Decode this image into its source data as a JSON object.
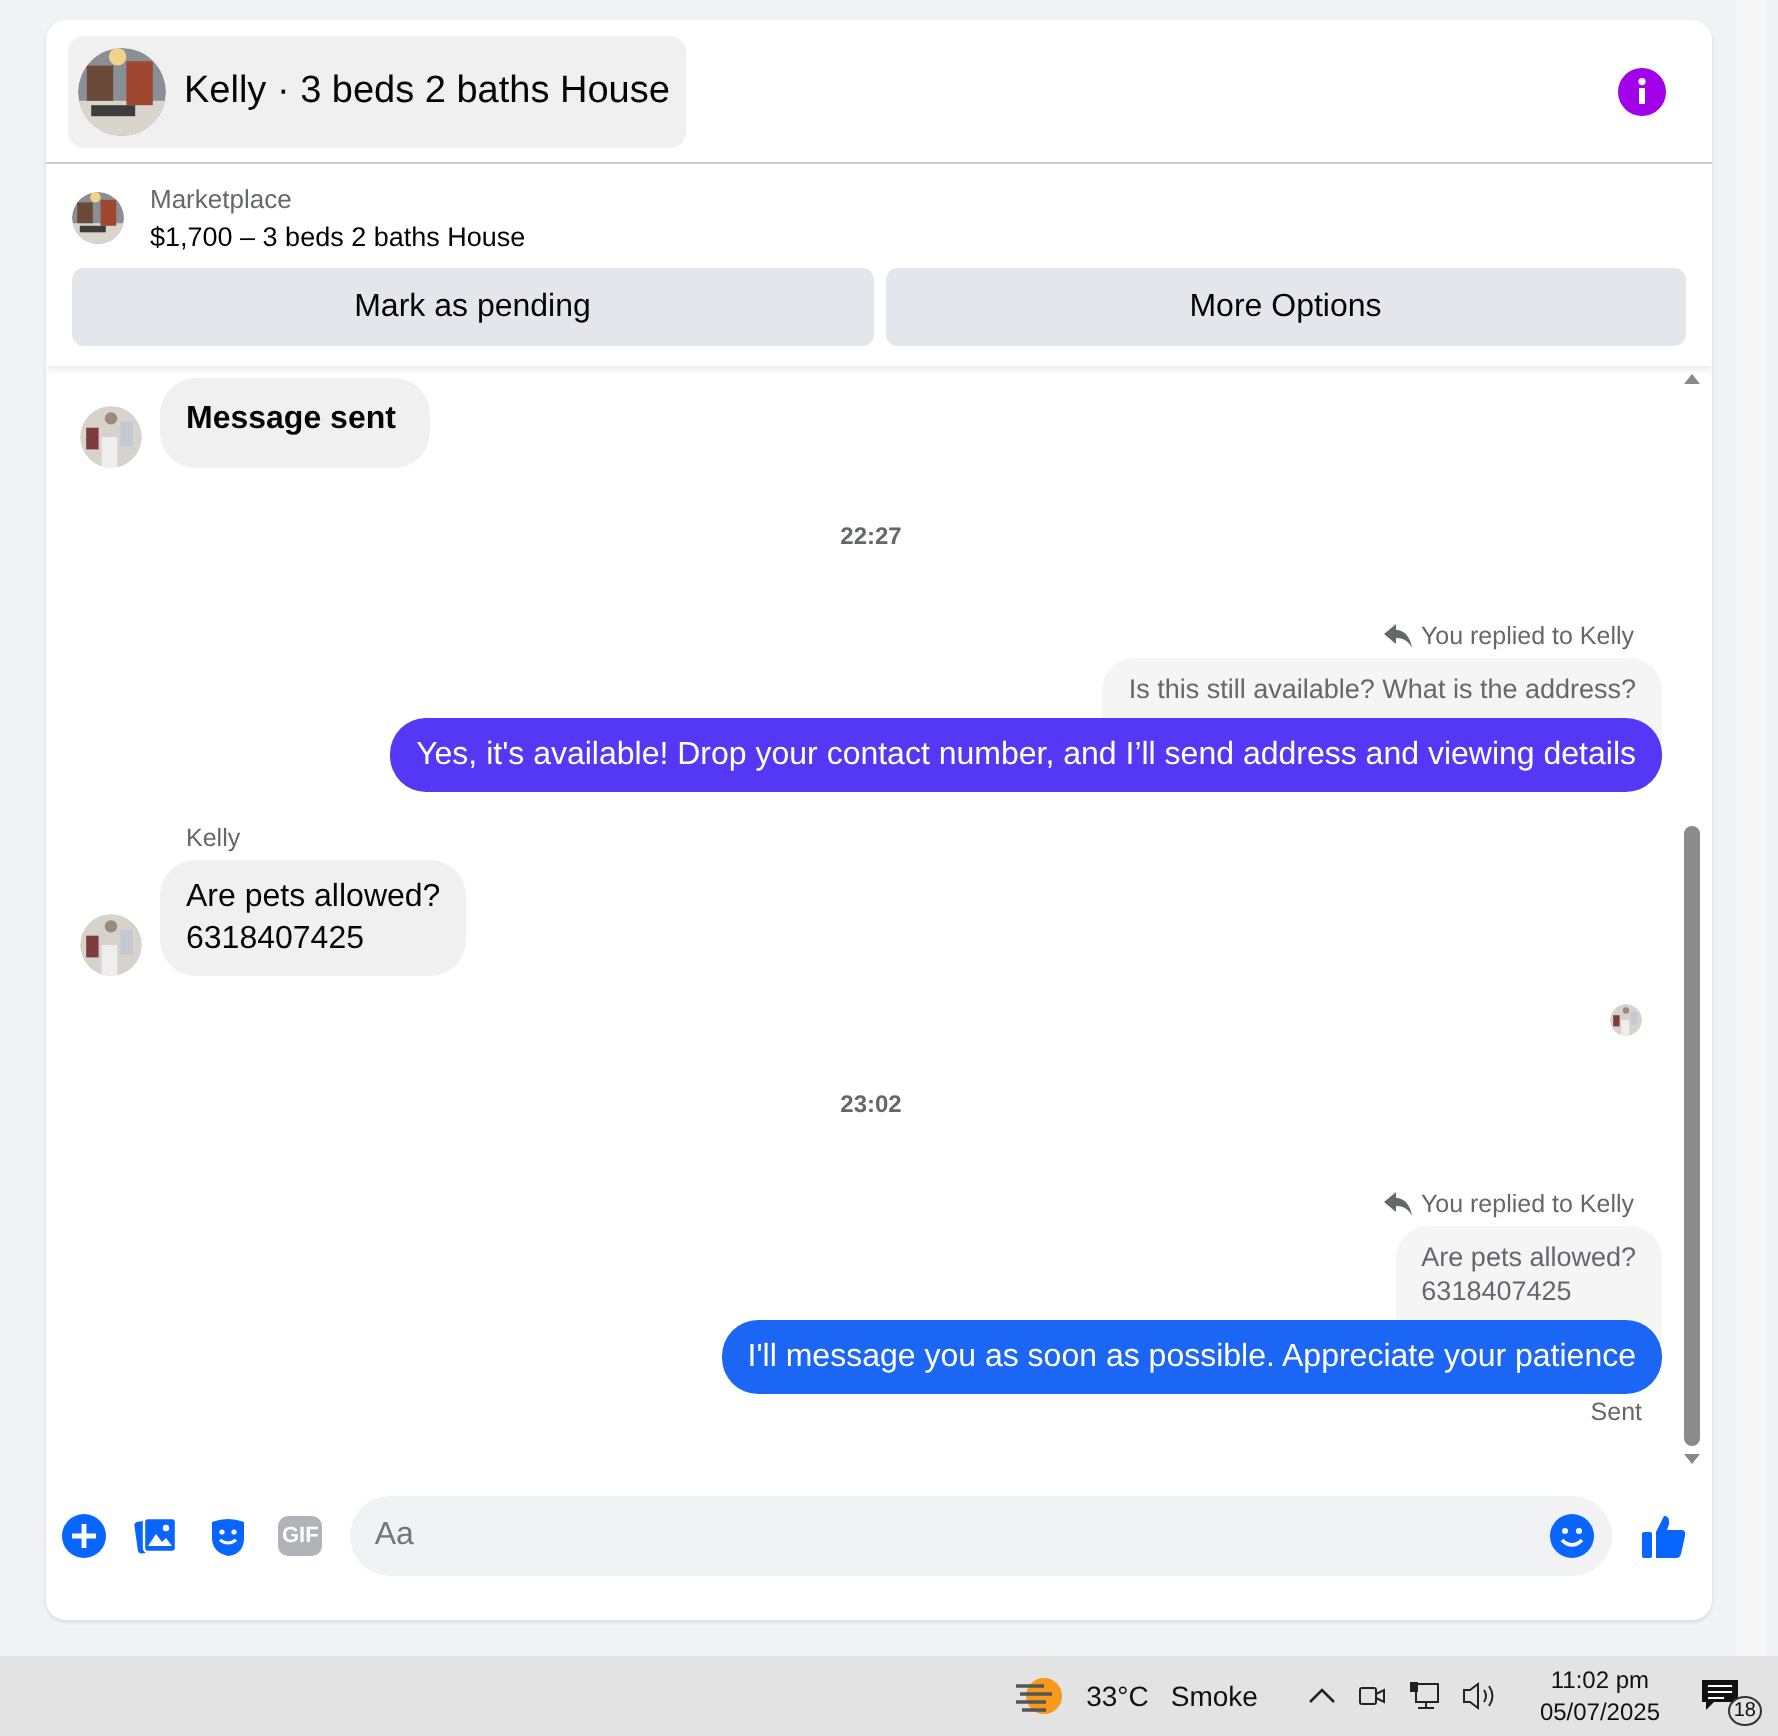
{
  "header": {
    "title": "Kelly · 3 beds 2 baths House"
  },
  "listing": {
    "source": "Marketplace",
    "title": "$1,700 – 3 beds 2 baths House"
  },
  "actions": [
    "Mark as pending",
    "More Options"
  ],
  "messages": [
    {
      "kind": "incoming",
      "text": "Message sent",
      "bold": true
    },
    {
      "kind": "timestamp",
      "text": "22:27"
    },
    {
      "kind": "outgoing",
      "reply_label": "You replied to Kelly",
      "reply_to": "Is this still available? What is the address?",
      "text": "Yes, it's available! Drop your contact number, and I’ll send address and viewing details",
      "color": "#5538f5"
    },
    {
      "kind": "incoming",
      "sender": "Kelly",
      "text": "Are pets allowed?\n6318407425",
      "bold": false
    },
    {
      "kind": "seen"
    },
    {
      "kind": "timestamp",
      "text": "23:02"
    },
    {
      "kind": "outgoing",
      "reply_label": "You replied to Kelly",
      "reply_to": "Are pets allowed?\n6318407425",
      "text": "I'll message you as soon as possible. Appreciate your patience",
      "color": "#1b66f5"
    },
    {
      "kind": "status",
      "text": "Sent"
    }
  ],
  "composer": {
    "placeholder": "Aa",
    "gif_label": "GIF"
  },
  "taskbar": {
    "temperature": "33°C",
    "weather": "Smoke",
    "time": "11:02 pm",
    "date": "05/07/2025",
    "notifications": "18"
  }
}
